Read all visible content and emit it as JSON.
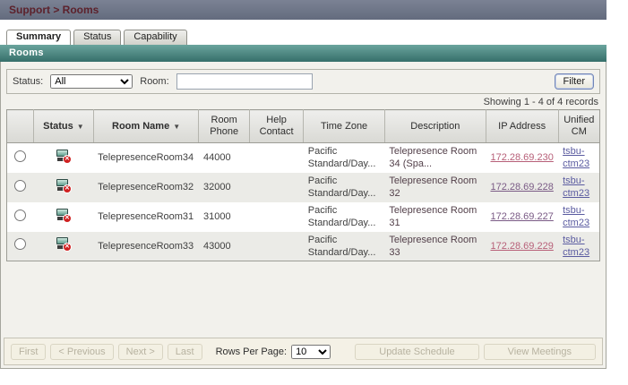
{
  "theme": {
    "titlebar_bg": "#6b7284",
    "title_text": "#5c212b",
    "teal_bar": "#3f7a74",
    "cm_link": "#5a5ba0",
    "ip_link_pink": "#b75f78",
    "ip_link_purple": "#7a5a85",
    "status_error_red": "#cf2020"
  },
  "icons": {
    "sort_desc": "▼"
  },
  "title_bar": {
    "text": "Support > Rooms"
  },
  "tabs": [
    {
      "label": "Summary"
    },
    {
      "label": "Status"
    },
    {
      "label": "Capability"
    }
  ],
  "section_bar": {
    "label": "Rooms"
  },
  "filter": {
    "status_label": "Status:",
    "status_value": "All",
    "room_label": "Room:",
    "room_value": "",
    "filter_button": "Filter"
  },
  "showing_text": "Showing 1 - 4 of 4 records",
  "table": {
    "columns": [
      "",
      "Status",
      "Room Name",
      "Room Phone",
      "Help Contact",
      "Time Zone",
      "Description",
      "IP Address",
      "Unified CM"
    ],
    "rows": [
      {
        "name": "TelepresenceRoom34",
        "phone": "44000",
        "help": "",
        "tz1": "Pacific",
        "tz2": "Standard/Day...",
        "desc1": "Telepresence Room",
        "desc2": "34 (Spa...",
        "ip": "172.28.69.230",
        "ip_color": "#b75f78",
        "cm1": "tsbu-",
        "cm2": "ctm23"
      },
      {
        "name": "TelepresenceRoom32",
        "phone": "32000",
        "help": "",
        "tz1": "Pacific",
        "tz2": "Standard/Day...",
        "desc1": "Telepresence Room",
        "desc2": "32",
        "ip": "172.28.69.228",
        "ip_color": "#7a5a85",
        "cm1": "tsbu-",
        "cm2": "ctm23"
      },
      {
        "name": "TelepresenceRoom31",
        "phone": "31000",
        "help": "",
        "tz1": "Pacific",
        "tz2": "Standard/Day...",
        "desc1": "Telepresence Room",
        "desc2": "31",
        "ip": "172.28.69.227",
        "ip_color": "#7a5a85",
        "cm1": "tsbu-",
        "cm2": "ctm23"
      },
      {
        "name": "TelepresenceRoom33",
        "phone": "43000",
        "help": "",
        "tz1": "Pacific",
        "tz2": "Standard/Day...",
        "desc1": "Telepresence Room",
        "desc2": "33",
        "ip": "172.28.69.229",
        "ip_color": "#b75f78",
        "cm1": "tsbu-",
        "cm2": "ctm23"
      }
    ]
  },
  "pager": {
    "first": "First",
    "previous": "< Previous",
    "next": "Next >",
    "last": "Last",
    "rows_per_page_label": "Rows Per Page:",
    "rows_per_page_value": "10",
    "update_schedule": "Update Schedule",
    "view_meetings": "View Meetings"
  }
}
